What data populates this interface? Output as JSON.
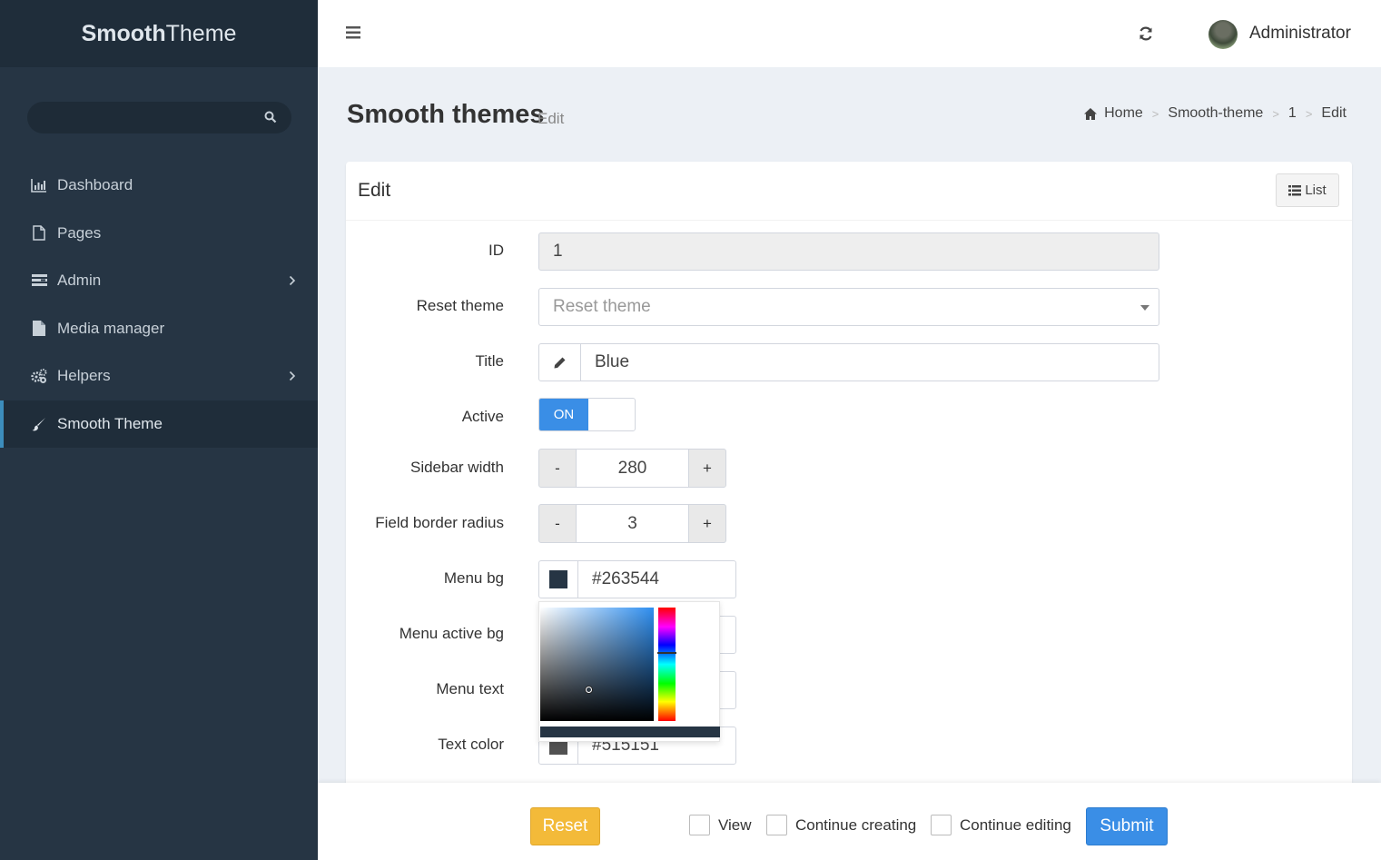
{
  "app": {
    "logo_bold": "Smooth",
    "logo_light": "Theme"
  },
  "sidebar": {
    "items": [
      {
        "label": "Dashboard",
        "icon": "bar-chart-icon"
      },
      {
        "label": "Pages",
        "icon": "file-icon"
      },
      {
        "label": "Admin",
        "icon": "tasks-icon",
        "has_children": true
      },
      {
        "label": "Media manager",
        "icon": "file-solid-icon"
      },
      {
        "label": "Helpers",
        "icon": "gears-icon",
        "has_children": true
      },
      {
        "label": "Smooth Theme",
        "icon": "paint-brush-icon",
        "active": true
      }
    ]
  },
  "header": {
    "username": "Administrator"
  },
  "page": {
    "title": "Smooth themes",
    "subtitle": "Edit",
    "breadcrumb": [
      "Home",
      "Smooth-theme",
      "1",
      "Edit"
    ]
  },
  "box": {
    "title": "Edit",
    "list_label": "List"
  },
  "form": {
    "id_label": "ID",
    "id_value": "1",
    "reset_theme_label": "Reset theme",
    "reset_theme_placeholder": "Reset theme",
    "title_label": "Title",
    "title_value": "Blue",
    "active_label": "Active",
    "active_on": "ON",
    "sidebar_width_label": "Sidebar width",
    "sidebar_width_value": "280",
    "border_radius_label": "Field border radius",
    "border_radius_value": "3",
    "minus": "-",
    "plus": "+",
    "menu_bg_label": "Menu bg",
    "menu_bg_value": "#263544",
    "menu_active_bg_label": "Menu active bg",
    "menu_text_label": "Menu text",
    "text_color_label": "Text color",
    "text_color_value": "#515151"
  },
  "colors": {
    "menu_bg": "#263544",
    "text_color": "#515151",
    "accent": "#3a8ee6",
    "warning": "#f3ba39"
  },
  "footer": {
    "reset": "Reset",
    "view": "View",
    "continue_creating": "Continue creating",
    "continue_editing": "Continue editing",
    "submit": "Submit"
  }
}
